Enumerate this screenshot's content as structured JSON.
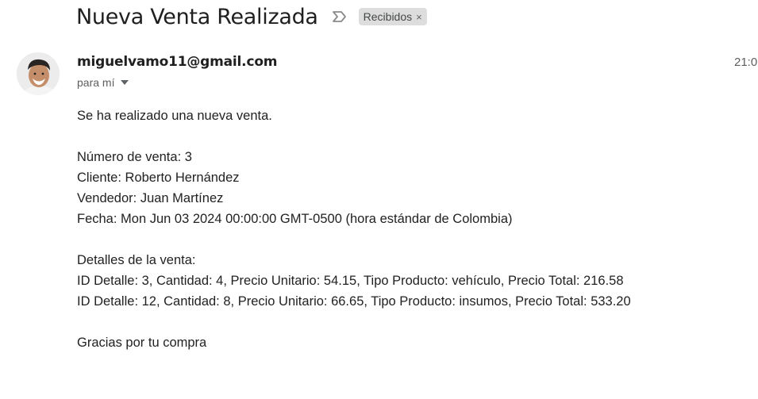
{
  "email": {
    "subject": "Nueva Venta Realizada",
    "label": "Recibidos",
    "label_close": "×",
    "sender": "miguelvamo11@gmail.com",
    "recipient": "para mí",
    "time": "21:0"
  },
  "body": {
    "intro": "Se ha realizado una nueva venta.",
    "sale_number": "Número de venta: 3",
    "client": "Cliente: Roberto Hernández",
    "seller": "Vendedor: Juan Martínez",
    "date": "Fecha: Mon Jun 03 2024 00:00:00 GMT-0500 (hora estándar de Colombia)",
    "details_title": "Detalles de la venta:",
    "detail_lines": [
      "ID Detalle: 3, Cantidad: 4, Precio Unitario: 54.15, Tipo Producto: vehículo, Precio Total: 216.58",
      "ID Detalle: 12, Cantidad: 8, Precio Unitario: 66.65, Tipo Producto: insumos, Precio Total: 533.20"
    ],
    "closing": "Gracias por tu compra"
  },
  "icons": {
    "important": "important-marker-icon",
    "dropdown": "chevron-down-icon",
    "avatar": "sender-avatar"
  },
  "colors": {
    "label_chip_bg": "#dddddd",
    "text": "#202124",
    "muted": "#5e5e5e"
  }
}
